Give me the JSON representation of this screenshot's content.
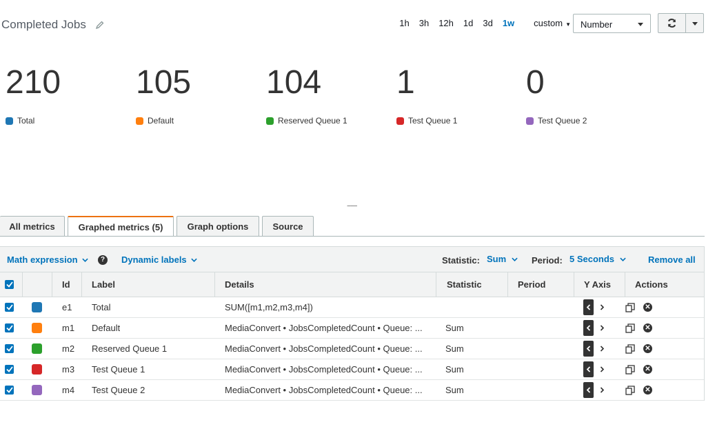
{
  "header": {
    "title": "Completed Jobs",
    "time_ranges": [
      "1h",
      "3h",
      "12h",
      "1d",
      "3d",
      "1w"
    ],
    "active_range": "1w",
    "custom_label": "custom",
    "view_type": "Number"
  },
  "stats": [
    {
      "value": "210",
      "label": "Total",
      "color": "#1f77b4"
    },
    {
      "value": "105",
      "label": "Default",
      "color": "#ff7f0e"
    },
    {
      "value": "104",
      "label": "Reserved Queue 1",
      "color": "#2ca02c"
    },
    {
      "value": "1",
      "label": "Test Queue 1",
      "color": "#d62728"
    },
    {
      "value": "0",
      "label": "Test Queue 2",
      "color": "#9467bd"
    }
  ],
  "tabs": [
    {
      "label": "All metrics",
      "active": false
    },
    {
      "label": "Graphed metrics (5)",
      "active": true
    },
    {
      "label": "Graph options",
      "active": false
    },
    {
      "label": "Source",
      "active": false
    }
  ],
  "toolbar": {
    "math_expression": "Math expression",
    "dynamic_labels": "Dynamic labels",
    "statistic_label": "Statistic:",
    "statistic_value": "Sum",
    "period_label": "Period:",
    "period_value": "5 Seconds",
    "remove_all": "Remove all"
  },
  "table": {
    "columns": [
      "Id",
      "Label",
      "Details",
      "Statistic",
      "Period",
      "Y Axis",
      "Actions"
    ],
    "rows": [
      {
        "id": "e1",
        "label": "Total",
        "details": "SUM([m1,m2,m3,m4])",
        "statistic": "",
        "period": "",
        "color": "#1f77b4"
      },
      {
        "id": "m1",
        "label": "Default",
        "details": "MediaConvert • JobsCompletedCount • Queue: ...",
        "statistic": "Sum",
        "period": "",
        "color": "#ff7f0e"
      },
      {
        "id": "m2",
        "label": "Reserved Queue 1",
        "details": "MediaConvert • JobsCompletedCount • Queue: ...",
        "statistic": "Sum",
        "period": "",
        "color": "#2ca02c"
      },
      {
        "id": "m3",
        "label": "Test Queue 1",
        "details": "MediaConvert • JobsCompletedCount • Queue: ...",
        "statistic": "Sum",
        "period": "",
        "color": "#d62728"
      },
      {
        "id": "m4",
        "label": "Test Queue 2",
        "details": "MediaConvert • JobsCompletedCount • Queue: ...",
        "statistic": "Sum",
        "period": "",
        "color": "#9467bd"
      }
    ]
  }
}
